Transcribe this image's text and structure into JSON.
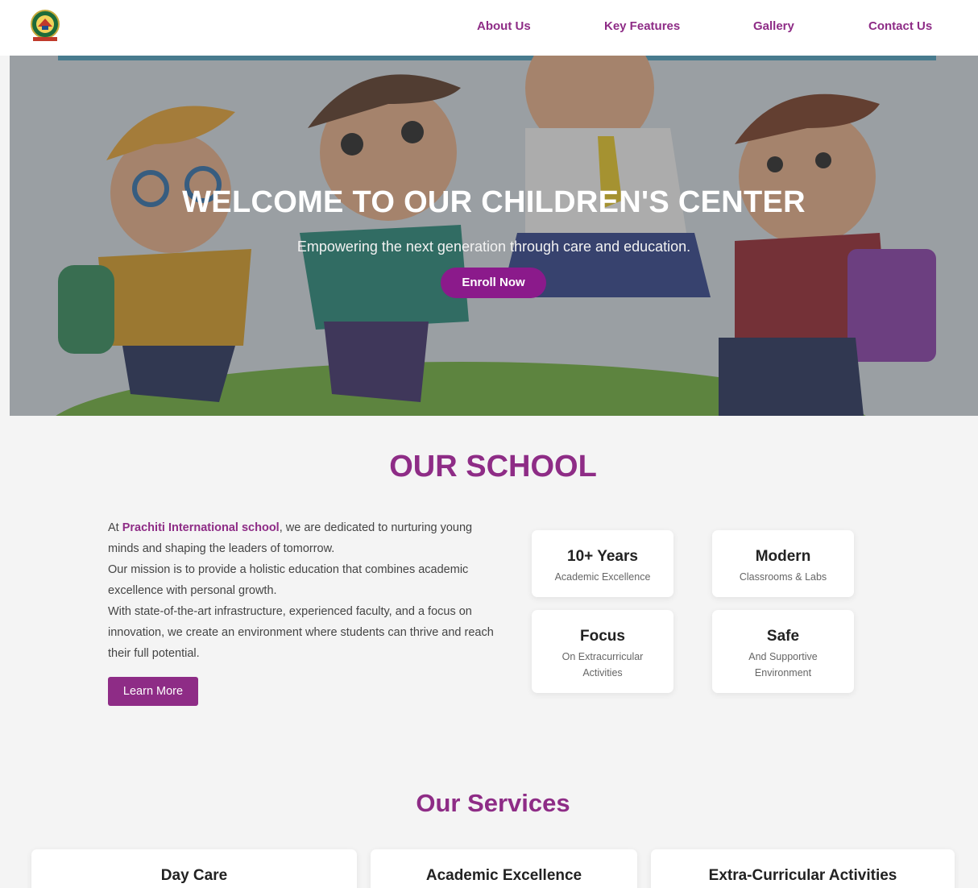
{
  "nav": {
    "items": [
      "About Us",
      "Key Features",
      "Gallery",
      "Contact Us"
    ]
  },
  "hero": {
    "title": "WELCOME TO OUR CHILDREN'S CENTER",
    "subtitle": "Empowering the next generation through care and education.",
    "cta": "Enroll Now"
  },
  "school": {
    "title": "OUR SCHOOL",
    "intro_prefix": "At ",
    "brand": "Prachiti International school",
    "intro_suffix": ", we are dedicated to nurturing young minds and shaping the leaders of tomorrow.",
    "mission": "Our mission is to provide a holistic education that combines academic excellence with personal growth.",
    "infra": "With state-of-the-art infrastructure, experienced faculty, and a focus on innovation, we create an environment where students can thrive and reach their full potential.",
    "learn_more": "Learn More",
    "stats": [
      {
        "big": "10+ Years",
        "small": "Academic Excellence"
      },
      {
        "big": "Modern",
        "small": "Classrooms & Labs"
      },
      {
        "big": "Focus",
        "small": "On Extracurricular Activities"
      },
      {
        "big": "Safe",
        "small": "And Supportive Environment"
      }
    ]
  },
  "services": {
    "title": "Our Services",
    "items": [
      "Day Care",
      "Academic Excellence",
      "Extra-Curricular Activities"
    ]
  },
  "colors": {
    "brand_purple": "#8e2c86",
    "button_purple": "#8b1a8b"
  }
}
